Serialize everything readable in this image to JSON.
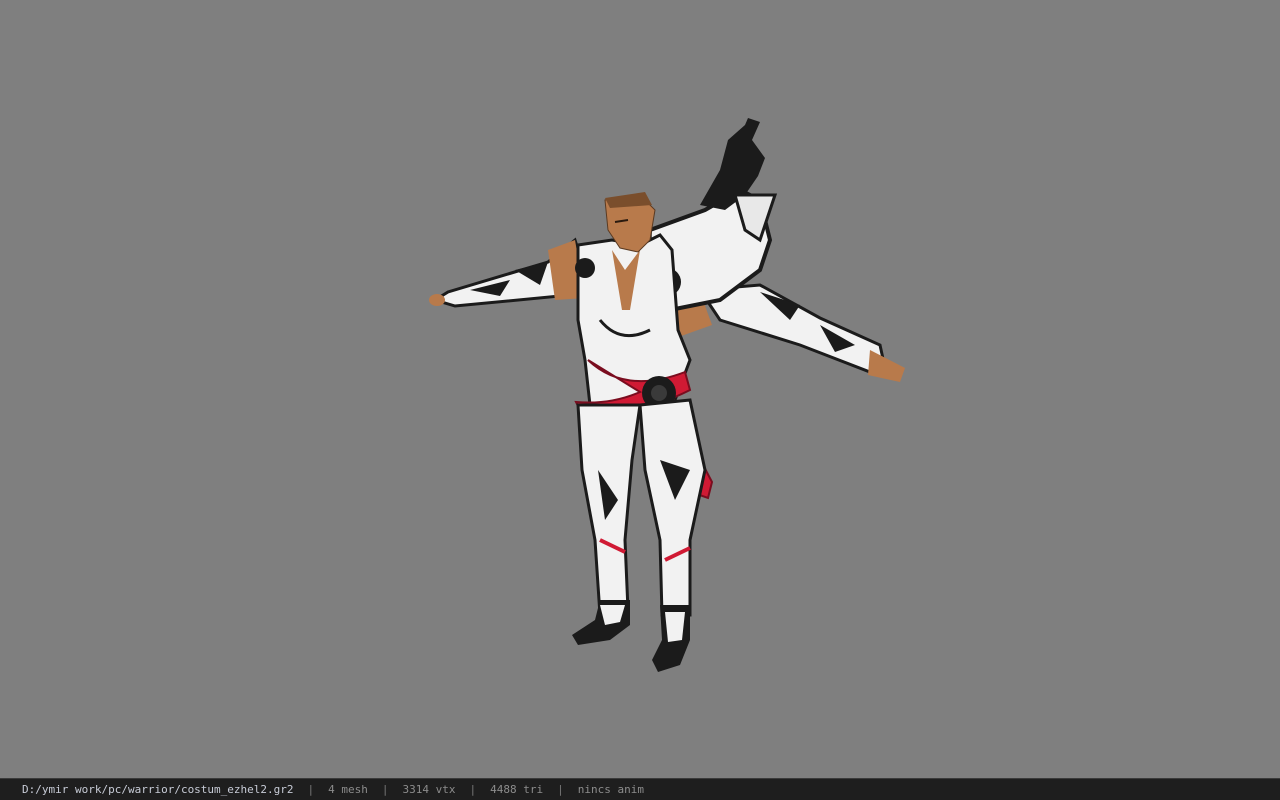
{
  "status": {
    "file_path": "D:/ymir work/pc/warrior/costum_ezhel2.gr2",
    "separator": "|",
    "mesh_count": "4 mesh",
    "vertex_count": "3314 vtx",
    "triangle_count": "4488 tri",
    "animation": "nincs anim"
  },
  "colors": {
    "viewport_bg": "#7f7f7f",
    "statusbar_bg": "#1e1e1e",
    "armor_white": "#f2f2f2",
    "armor_black": "#1b1b1b",
    "sash_red": "#d01a34",
    "skin": "#b87a4b"
  }
}
